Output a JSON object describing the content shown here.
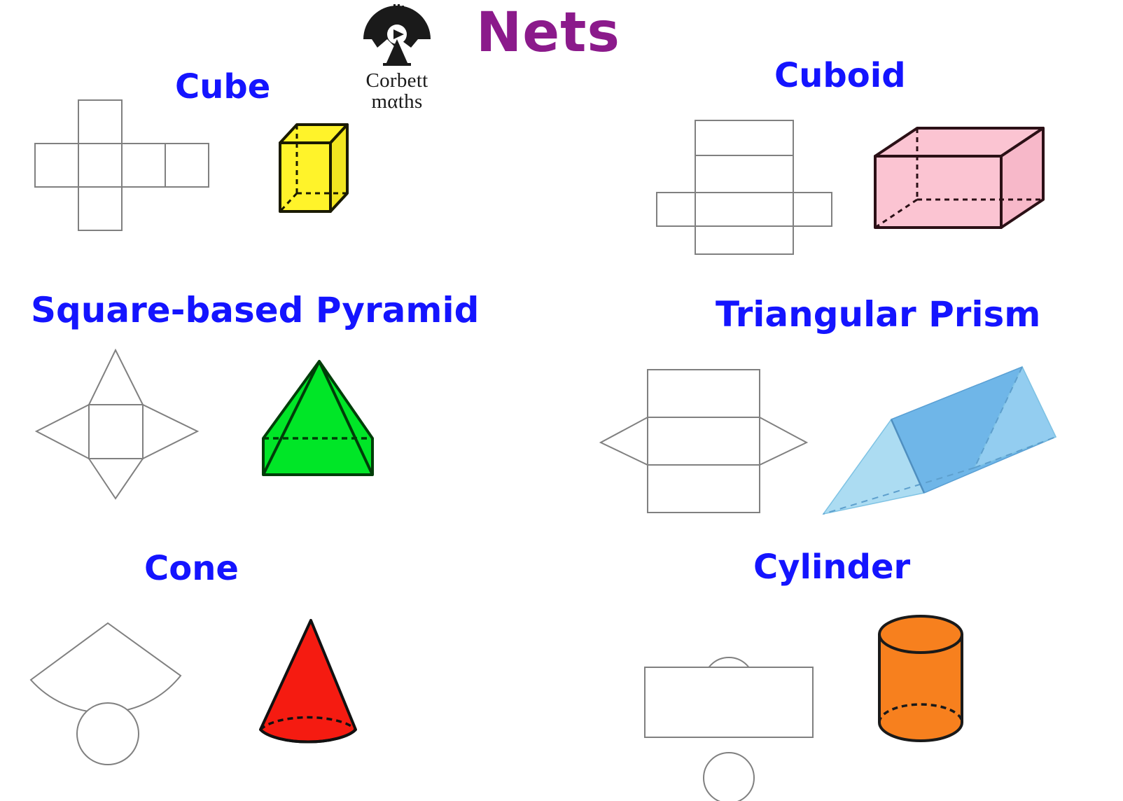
{
  "page": {
    "background": "#ffffff",
    "title": "Nets",
    "title_color": "#8b1a8b",
    "label_color": "#1414ff"
  },
  "logo": {
    "name": "corbettmaths-logo",
    "line1": "Corbett",
    "line2": "mαths",
    "mark_color": "#1a1a1a"
  },
  "shapes": [
    {
      "id": "cube",
      "label": "Cube",
      "net": "cross-of-six-squares",
      "solid_color": "#FFF32A",
      "solid_stroke": "#1a1a00"
    },
    {
      "id": "cuboid",
      "label": "Cuboid",
      "net": "cross-of-six-rectangles",
      "solid_color": "#FBC4D2",
      "solid_stroke": "#2b1016"
    },
    {
      "id": "square-based-pyramid",
      "label": "Square-based Pyramid",
      "net": "square-with-four-triangles",
      "solid_color": "#00E627",
      "solid_stroke": "#003d09"
    },
    {
      "id": "triangular-prism",
      "label": "Triangular Prism",
      "net": "three-rectangles-with-two-triangles",
      "solid_color": "#6FB6E8",
      "solid_color_light": "#ACDCF2",
      "solid_color_mid": "#8FCBEE",
      "solid_stroke": "#4f8fc0"
    },
    {
      "id": "cone",
      "label": "Cone",
      "net": "sector-with-circle",
      "solid_color": "#F51B11",
      "solid_stroke": "#111111"
    },
    {
      "id": "cylinder",
      "label": "Cylinder",
      "net": "rectangle-with-two-circles",
      "solid_color": "#F7801E",
      "solid_stroke": "#1a1a1a"
    }
  ]
}
